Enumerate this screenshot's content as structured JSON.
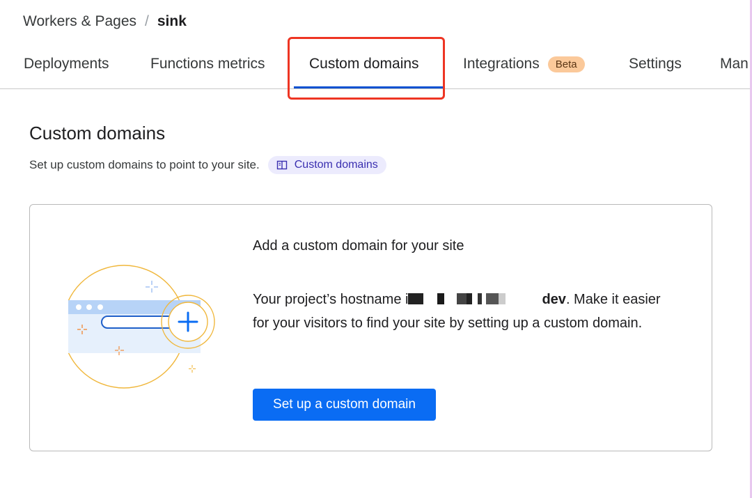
{
  "breadcrumb": {
    "parent": "Workers & Pages",
    "separator": "/",
    "current": "sink"
  },
  "tabs": [
    {
      "label": "Deployments"
    },
    {
      "label": "Functions metrics"
    },
    {
      "label": "Custom domains",
      "active": true
    },
    {
      "label": "Integrations",
      "badge": "Beta"
    },
    {
      "label": "Settings"
    },
    {
      "label": "Man"
    }
  ],
  "section": {
    "title": "Custom domains",
    "description": "Set up custom domains to point to your site.",
    "doc_link_label": "Custom domains",
    "doc_link_icon": "book-icon"
  },
  "card": {
    "heading": "Add a custom domain for your site",
    "body_prefix": "Your project’s hostname i",
    "body_hostname_suffix": "dev",
    "body_rest": ". Make it easier for your visitors to find your site by setting up a custom domain.",
    "button_label": "Set up a custom domain"
  },
  "colors": {
    "accent_blue": "#0a6cf3",
    "tab_underline": "#0b52d1",
    "highlight_red": "#ee3523",
    "beta_badge": "#fbc99a",
    "doc_pill_bg": "#ecebfd"
  }
}
